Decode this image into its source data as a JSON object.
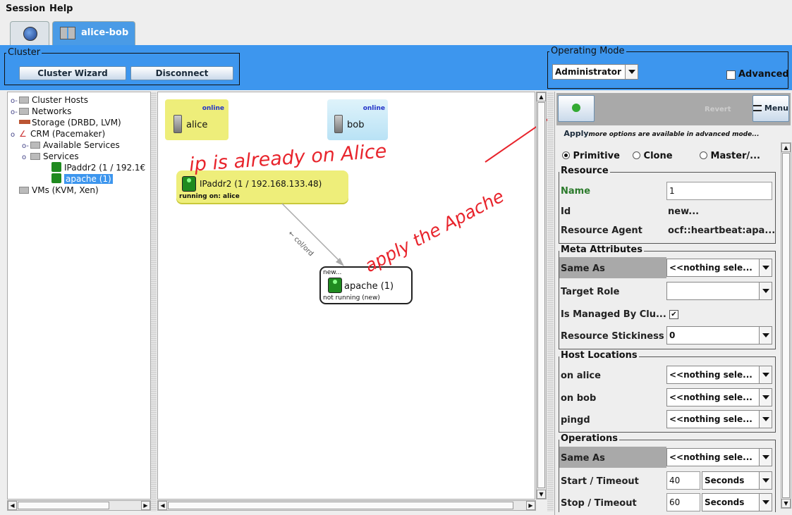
{
  "menubar": {
    "session": "Session",
    "help": "Help"
  },
  "tabs": [
    {
      "label": ""
    },
    {
      "label": "alice-bob"
    }
  ],
  "header": {
    "cluster_legend": "Cluster",
    "cluster_wizard": "Cluster Wizard",
    "disconnect": "Disconnect",
    "opmode_legend": "Operating Mode",
    "opmode_value": "Administrator",
    "advanced_label": "Advanced"
  },
  "tree": {
    "items": [
      {
        "label": "Cluster Hosts"
      },
      {
        "label": "Networks"
      },
      {
        "label": "Storage (DRBD, LVM)"
      },
      {
        "label": "CRM (Pacemaker)"
      },
      {
        "label": "Available Services"
      },
      {
        "label": "Services"
      },
      {
        "label": "IPaddr2 (1 / 192.1€"
      },
      {
        "label": "apache (1)"
      },
      {
        "label": "VMs (KVM, Xen)"
      }
    ]
  },
  "graph": {
    "alice": {
      "name": "alice",
      "status": "online"
    },
    "bob": {
      "name": "bob",
      "status": "online"
    },
    "ipaddr": {
      "label": "IPaddr2 (1 / 192.168.133.48)",
      "running": "running on: alice"
    },
    "apache": {
      "new": "new...",
      "label": "apache (1)",
      "running": "not running (new)"
    },
    "edge_label": "← col/ord",
    "annotation_1": "ip is already on Alice",
    "annotation_2": "apply the Apache"
  },
  "right": {
    "apply": "Apply",
    "revert": "Revert",
    "menu": "Menu",
    "advanced_hint": "more options are available in advanced mode...",
    "radio_primitive": "Primitive",
    "radio_clone": "Clone",
    "radio_master": "Master/...",
    "resource_legend": "Resource",
    "name_label": "Name",
    "name_value": "1",
    "id_label": "Id",
    "id_value": "new...",
    "agent_label": "Resource Agent",
    "agent_value": "ocf::heartbeat:apa...",
    "meta_legend": "Meta Attributes",
    "same_as_label": "Same As",
    "same_as_value": "<<nothing sele...",
    "target_role_label": "Target Role",
    "target_role_value": "",
    "managed_label": "Is Managed By Clu...",
    "managed_check": "✔",
    "stickiness_label": "Resource Stickiness",
    "stickiness_value": "0",
    "host_legend": "Host Locations",
    "on_alice_label": "on alice",
    "on_alice_value": "<<nothing sele...",
    "on_bob_label": "on bob",
    "on_bob_value": "<<nothing sele...",
    "pingd_label": "pingd",
    "pingd_value": "<<nothing sele...",
    "ops_legend": "Operations",
    "ops_same_as_label": "Same As",
    "ops_same_as_value": "<<nothing sele...",
    "start_label": "Start / Timeout",
    "start_value": "40",
    "start_unit": "Seconds",
    "stop_label": "Stop / Timeout",
    "stop_value": "60",
    "stop_unit": "Seconds"
  },
  "colors": {
    "header_blue": "#3d96ee",
    "annotation_red": "#e8242c",
    "alice_node": "#eeee7a",
    "bob_node": "#bfe6f7"
  }
}
